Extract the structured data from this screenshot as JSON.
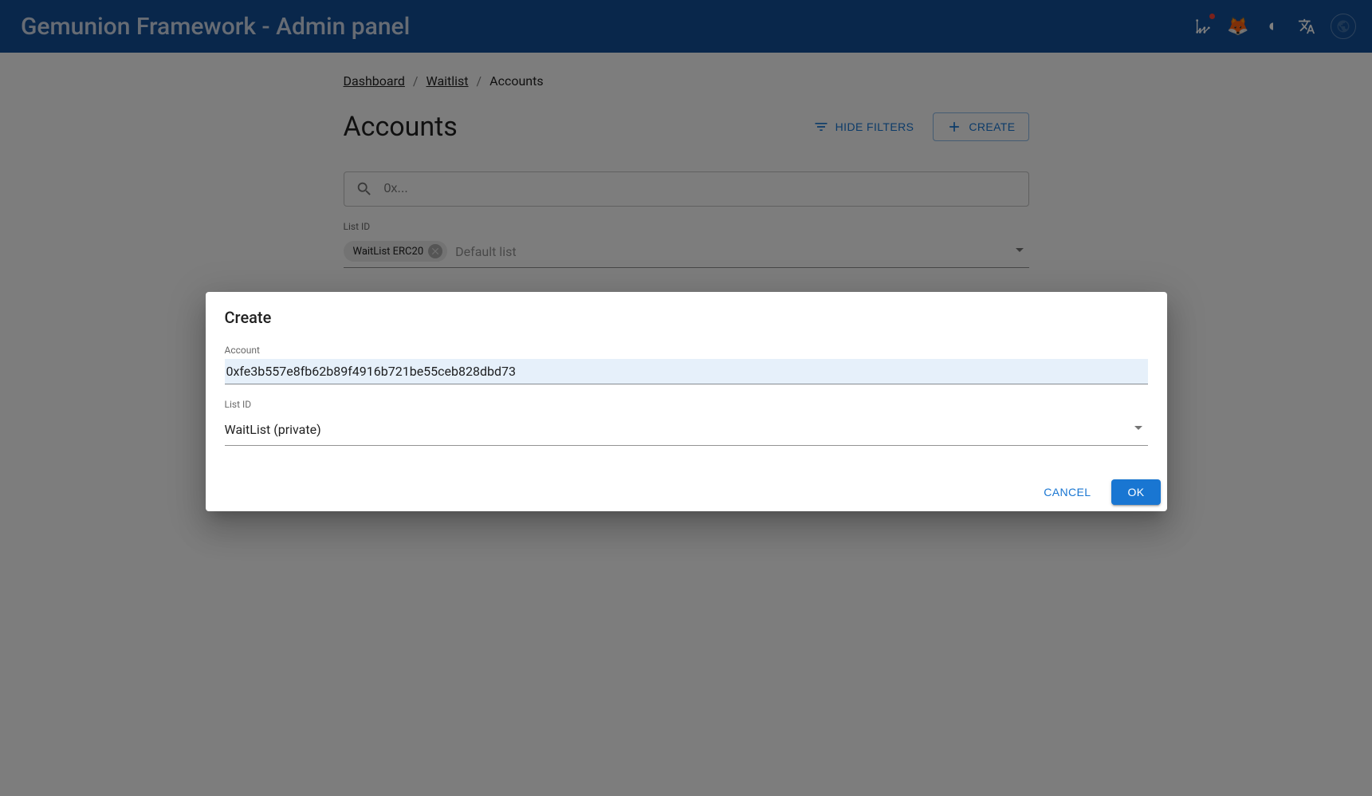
{
  "header": {
    "title": "Gemunion Framework - Admin panel"
  },
  "breadcrumbs": {
    "items": [
      {
        "label": "Dashboard",
        "link": true
      },
      {
        "label": "Waitlist",
        "link": true
      },
      {
        "label": "Accounts",
        "link": false
      }
    ]
  },
  "page": {
    "title": "Accounts",
    "hide_filters_label": "HIDE FILTERS",
    "create_label": "CREATE"
  },
  "search": {
    "placeholder": "0x..."
  },
  "filter": {
    "list_id_label": "List ID",
    "chip_label": "WaitList ERC20",
    "placeholder": "Default list"
  },
  "dialog": {
    "title": "Create",
    "account_label": "Account",
    "account_value": "0xfe3b557e8fb62b89f4916b721be55ceb828dbd73",
    "list_id_label": "List ID",
    "list_id_value": "WaitList (private)",
    "cancel_label": "CANCEL",
    "ok_label": "OK"
  }
}
